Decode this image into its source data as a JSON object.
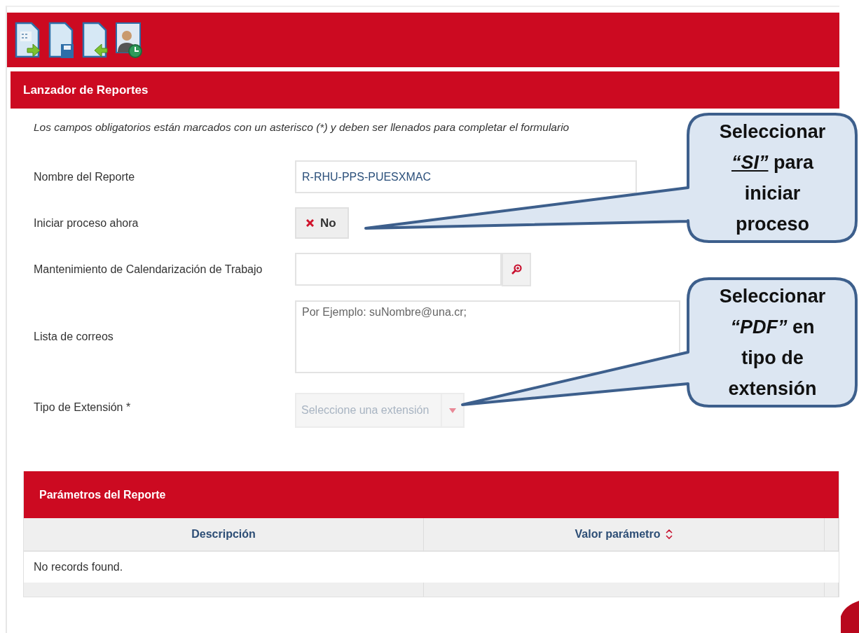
{
  "section": {
    "title": "Lanzador de Reportes"
  },
  "instructions": "Los campos obligatorios están marcados con un asterisco (*) y deben ser llenados para completar el formulario",
  "fields": [
    {
      "kind": "text",
      "label": "Nombre del Reporte",
      "value": "R-RHU-PPS-PUESXMAC"
    },
    {
      "kind": "toggle",
      "label": "Iniciar proceso ahora",
      "value": "No",
      "on": false
    },
    {
      "kind": "lookup",
      "label": "Mantenimiento de Calendarización de Trabajo"
    },
    {
      "kind": "textarea",
      "label": "Lista de correos",
      "placeholder": "Por Ejemplo:   suNombre@una.cr;"
    },
    {
      "kind": "select",
      "label": "Tipo de Extensión *",
      "placeholder": "Seleccione una extensión",
      "disabled": true
    }
  ],
  "parameters": {
    "title": "Parámetros del Reporte",
    "columns": [
      {
        "label": "Descripción",
        "sortable": false
      },
      {
        "label": "Valor parámetro",
        "sortable": true
      }
    ],
    "empty_message": "No records found."
  },
  "callouts": [
    {
      "text": "Seleccionar *“SI”* para iniciar proceso",
      "underlined": true
    },
    {
      "text": "Seleccionar *“PDF”* en tipo de extensión",
      "underlined": false
    }
  ]
}
